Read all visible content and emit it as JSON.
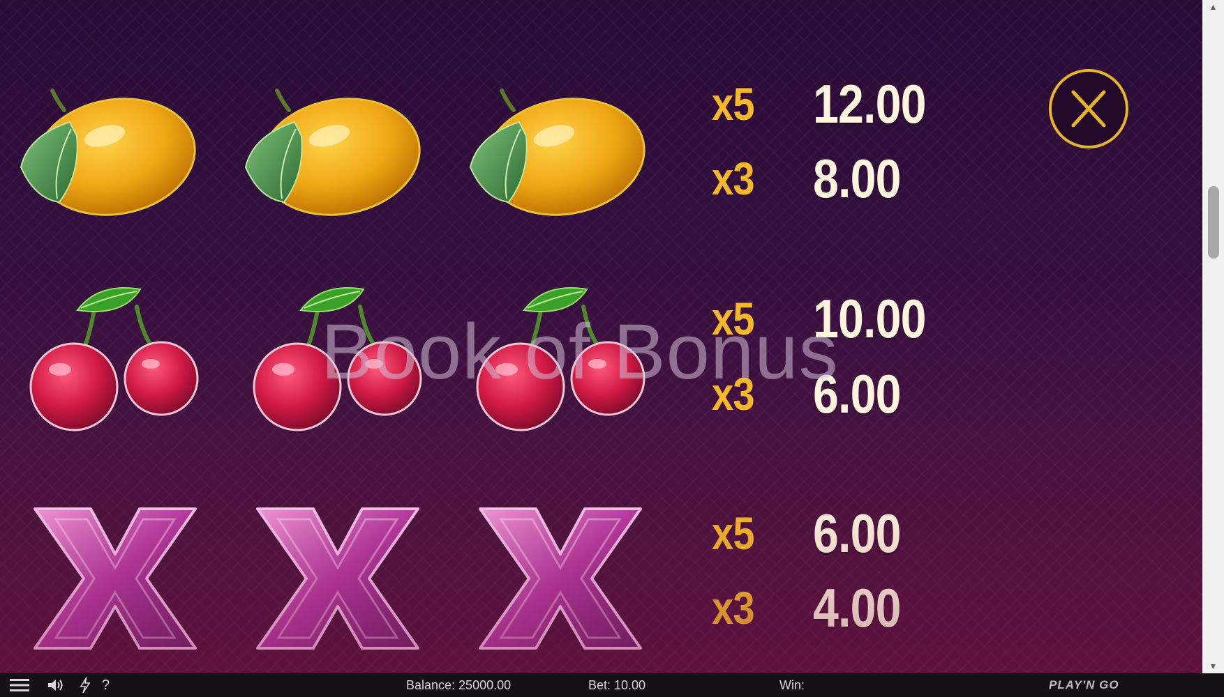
{
  "paytable": {
    "rows": [
      {
        "symbol": "lemon",
        "count": 3,
        "payouts": [
          {
            "mult": "x5",
            "amount": "12.00"
          },
          {
            "mult": "x3",
            "amount": "8.00"
          }
        ]
      },
      {
        "symbol": "cherry",
        "count": 3,
        "payouts": [
          {
            "mult": "x5",
            "amount": "10.00"
          },
          {
            "mult": "x3",
            "amount": "6.00"
          }
        ]
      },
      {
        "symbol": "purple-x",
        "count": 3,
        "payouts": [
          {
            "mult": "x5",
            "amount": "6.00"
          },
          {
            "mult": "x3",
            "amount": "4.00"
          }
        ]
      }
    ]
  },
  "watermark": "Book of Bonus",
  "close_button": {
    "glyph": "X",
    "icon": "close-icon"
  },
  "bottom_bar": {
    "menu_icon": "menu-icon",
    "sound_icon": "speaker-icon",
    "turbo_icon": "lightning-icon",
    "help_label": "?",
    "balance": "Balance: 25000.00",
    "bet": "Bet: 10.00",
    "win": "Win:",
    "brand": "PLAY'N GO"
  },
  "scrollbar": {
    "up": "▲",
    "down": "▼"
  },
  "colors": {
    "multiplier": "#f5b82a",
    "amount": "#fff5df",
    "accent_gold": "#e7b52b",
    "background": "#34103e"
  }
}
